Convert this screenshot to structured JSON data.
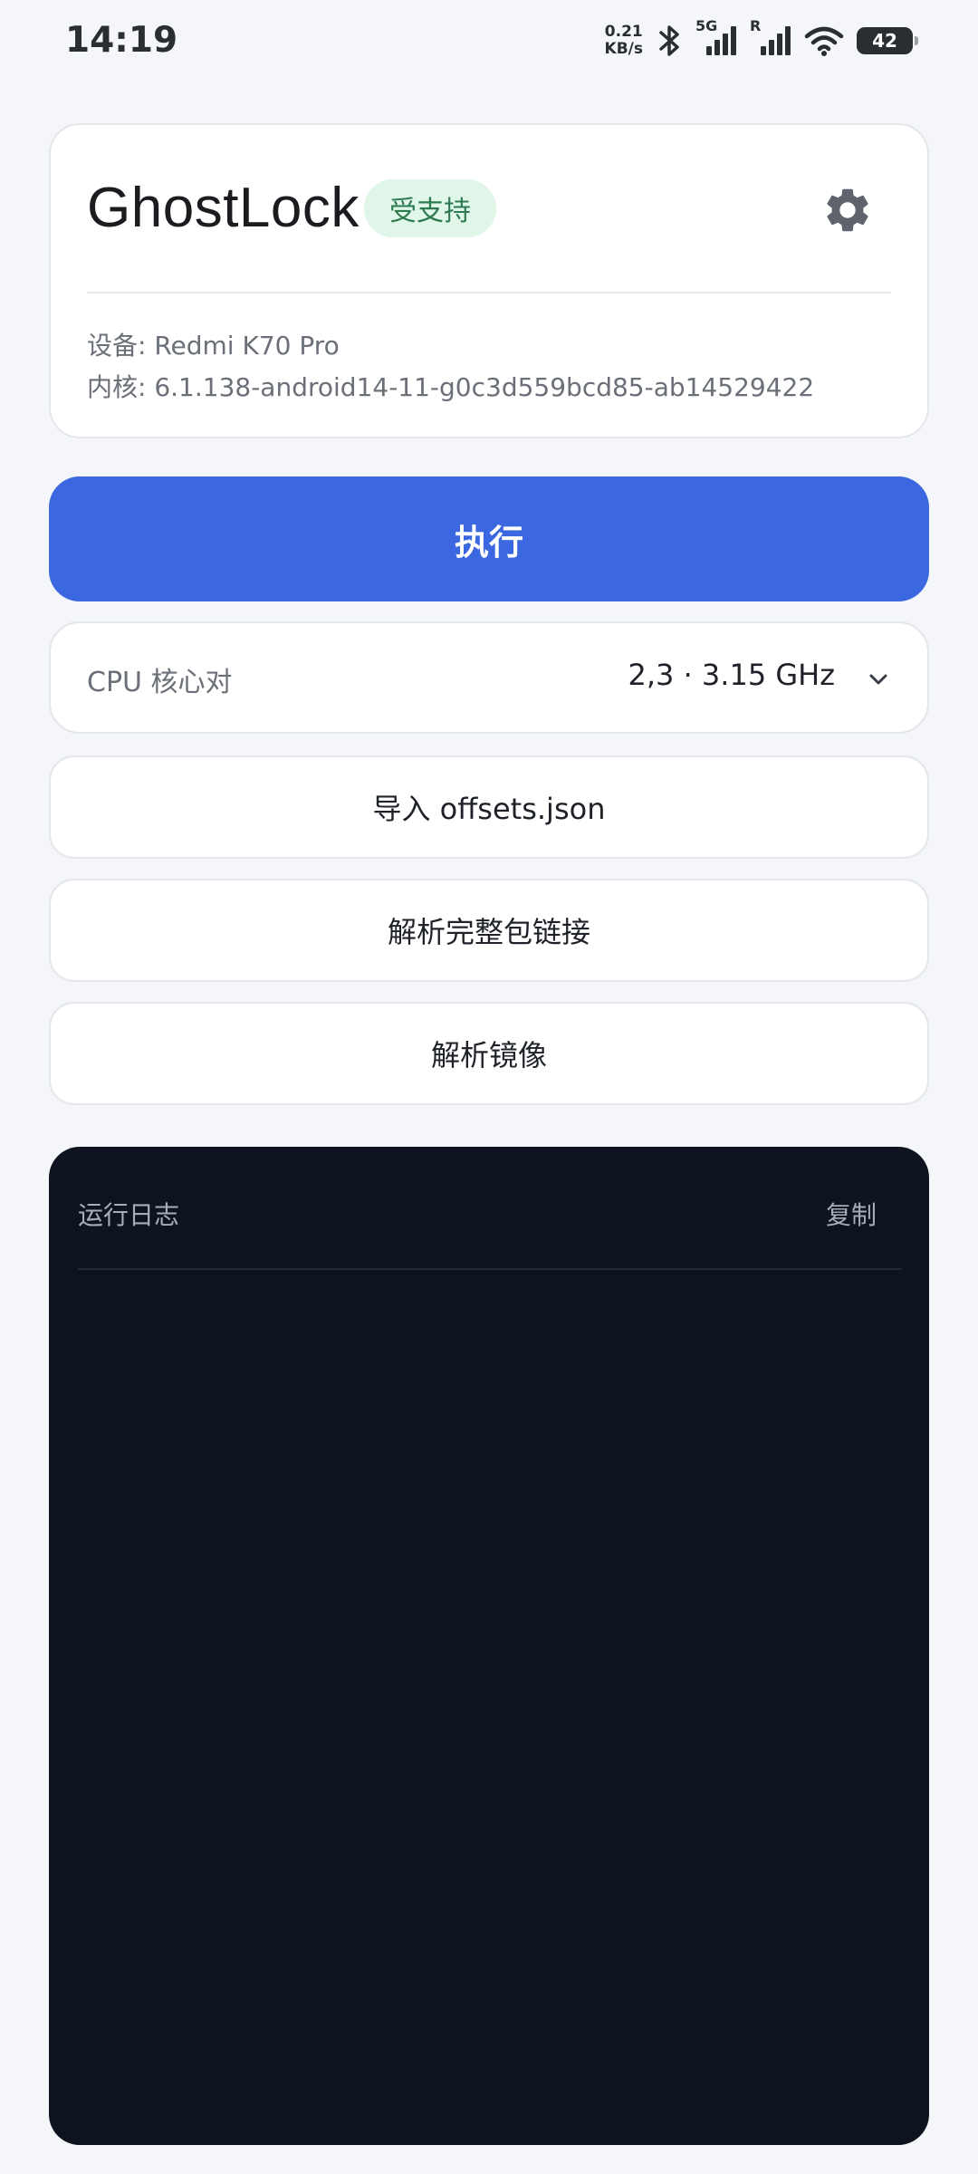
{
  "status_bar": {
    "time": "14:19",
    "net_speed_value": "0.21",
    "net_speed_unit": "KB/s",
    "network_type": "5G",
    "roaming_label": "R",
    "battery_level": "42",
    "icons": [
      "bluetooth-icon",
      "signal-icon",
      "signal-icon",
      "wifi-icon",
      "battery-icon"
    ]
  },
  "header": {
    "app_title": "GhostLock",
    "support_badge": "受支持",
    "device_line": "设备: Redmi K70 Pro",
    "kernel_line": "内核: 6.1.138-android14-11-g0c3d559bcd85-ab14529422",
    "settings_icon": "gear-icon"
  },
  "actions": {
    "run_label": "执行",
    "import_label": "导入 offsets.json",
    "parse_link_label": "解析完整包链接",
    "parse_image_label": "解析镜像"
  },
  "cpu_selector": {
    "label": "CPU 核心对",
    "selected_value": "2,3 · 3.15 GHz",
    "icon": "chevron-down-icon"
  },
  "log": {
    "title": "运行日志",
    "copy_label": "复制",
    "entries": []
  },
  "colors": {
    "accent": "#3b68e0",
    "badge_bg": "#dff6e8",
    "badge_text": "#2d7a4f",
    "log_bg": "#0e1320",
    "page_bg": "#f4f6f9"
  }
}
